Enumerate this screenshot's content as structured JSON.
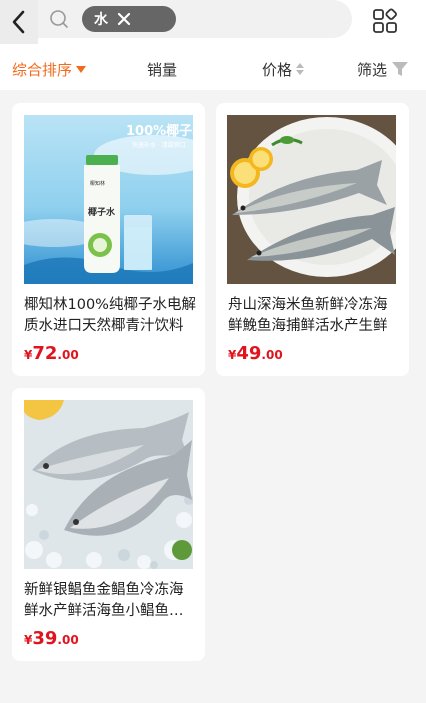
{
  "search": {
    "tag": "水"
  },
  "sort": {
    "default": "综合排序",
    "sales": "销量",
    "price": "价格",
    "filter": "筛选"
  },
  "colors": {
    "accent": "#f26b1d",
    "price": "#e0141e",
    "tag_bg": "#666666"
  },
  "products": [
    {
      "title": "椰知林100%纯椰子水电解质水进口天然椰青汁饮料",
      "price_int": "72",
      "price_dec": ".00",
      "currency": "¥",
      "image_text": "100%椰子水",
      "image_sub": "快速补水 · 清甜爽口",
      "bottle_brand": "椰知林",
      "bottle_label": "椰子水",
      "image": "coconut-water-bottle"
    },
    {
      "title": "舟山深海米鱼新鲜冷冻海鲜鮸鱼海捕鲜活水产生鲜",
      "price_int": "49",
      "price_dec": ".00",
      "currency": "¥",
      "image": "two-fish-on-plate"
    },
    {
      "title": "新鲜银鲳鱼金鲳鱼冷冻海鲜水产鲜活海鱼小鲳鱼整箱",
      "price_int": "39",
      "price_dec": ".00",
      "currency": "¥",
      "image": "pomfret-on-ice"
    }
  ]
}
